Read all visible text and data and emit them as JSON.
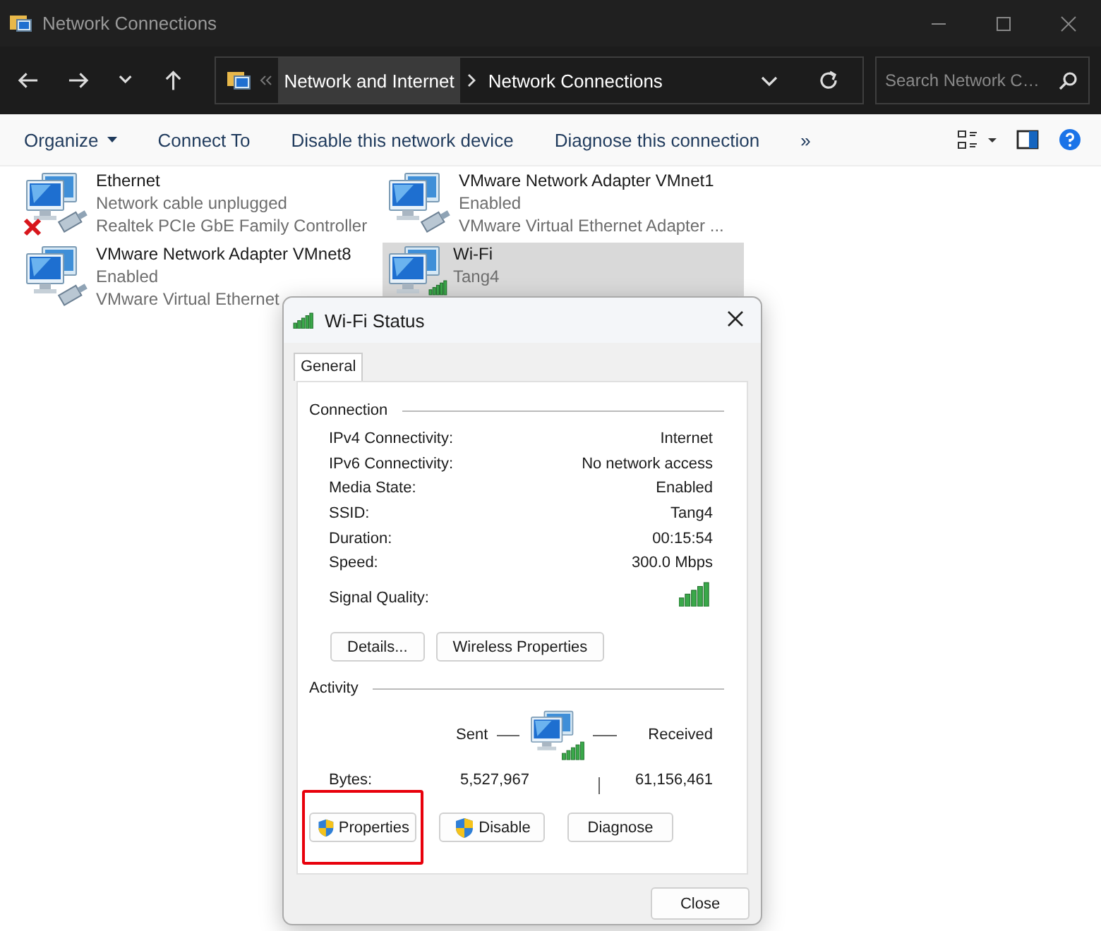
{
  "window": {
    "title": "Network Connections"
  },
  "address_bar": {
    "breadcrumbs": [
      {
        "label": "Network and Internet",
        "hovered": true
      },
      {
        "label": "Network Connections",
        "hovered": false
      }
    ],
    "search": {
      "placeholder": "Search Network C…"
    }
  },
  "toolbar": {
    "commands": [
      {
        "label": "Organize",
        "dropdown": true
      },
      {
        "label": "Connect To",
        "dropdown": false
      },
      {
        "label": "Disable this network device",
        "dropdown": false
      },
      {
        "label": "Diagnose this connection",
        "dropdown": false
      },
      {
        "label": "»",
        "dropdown": false
      }
    ]
  },
  "adapters": [
    {
      "name": "Ethernet",
      "status": "Network cable unplugged",
      "device": "Realtek PCIe GbE Family Controller",
      "kind": "wired",
      "connected": false,
      "selected": false
    },
    {
      "name": "VMware Network Adapter VMnet1",
      "status": "Enabled",
      "device": "VMware Virtual Ethernet Adapter ...",
      "kind": "wired",
      "connected": true,
      "selected": false
    },
    {
      "name": "VMware Network Adapter VMnet8",
      "status": "Enabled",
      "device": "VMware Virtual Ethernet",
      "kind": "wired",
      "connected": true,
      "selected": false
    },
    {
      "name": "Wi-Fi",
      "status": "Tang4",
      "kind": "wireless",
      "connected": true,
      "selected": true
    }
  ],
  "dialog": {
    "title": "Wi-Fi Status",
    "tabs": [
      {
        "label": "General",
        "selected": true
      }
    ],
    "connection": {
      "heading": "Connection",
      "rows": [
        {
          "label": "IPv4 Connectivity:",
          "value": "Internet"
        },
        {
          "label": "IPv6 Connectivity:",
          "value": "No network access"
        },
        {
          "label": "Media State:",
          "value": "Enabled"
        },
        {
          "label": "SSID:",
          "value": "Tang4"
        },
        {
          "label": "Duration:",
          "value": "00:15:54"
        },
        {
          "label": "Speed:",
          "value": "300.0 Mbps"
        }
      ],
      "signal_label": "Signal Quality:",
      "buttons": [
        "Details...",
        "Wireless Properties"
      ]
    },
    "activity": {
      "heading": "Activity",
      "sent_label": "Sent",
      "received_label": "Received",
      "bytes_label": "Bytes:",
      "bytes_sent": "5,527,967",
      "bytes_received": "61,156,461"
    },
    "buttons": [
      {
        "label": "Properties",
        "shield": true,
        "highlighted": true
      },
      {
        "label": "Disable",
        "shield": true,
        "highlighted": false
      },
      {
        "label": "Diagnose",
        "shield": false,
        "highlighted": false
      }
    ],
    "close_button": "Close"
  }
}
